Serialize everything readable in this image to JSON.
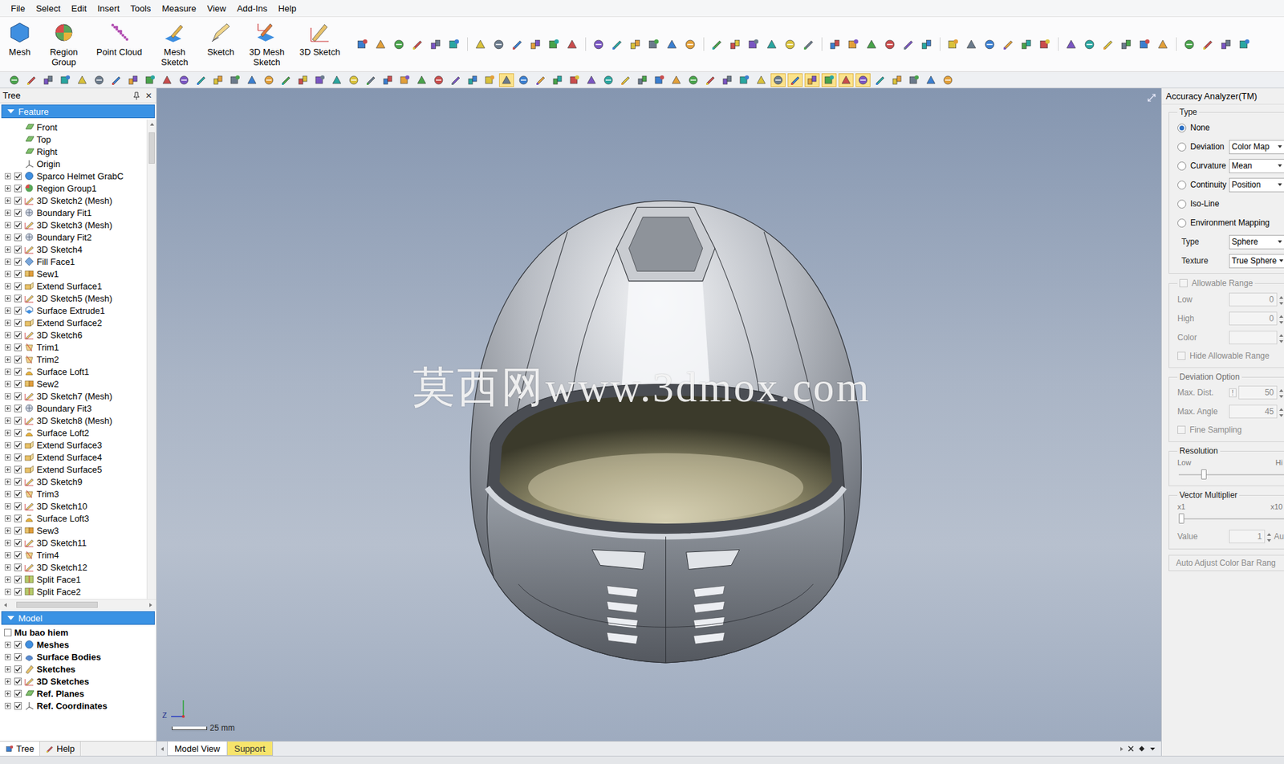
{
  "menu": [
    "File",
    "Select",
    "Edit",
    "Insert",
    "Tools",
    "Measure",
    "View",
    "Add-Ins",
    "Help"
  ],
  "ribbon": [
    {
      "label": "Mesh",
      "kind": "mesh"
    },
    {
      "label": "Region Group",
      "kind": "region"
    },
    {
      "label": "Point Cloud",
      "kind": "cloud"
    },
    {
      "label": "Mesh Sketch",
      "kind": "meshsketch"
    },
    {
      "label": "Sketch",
      "kind": "sketch"
    },
    {
      "label": "3D Mesh Sketch",
      "kind": "mesh3d"
    },
    {
      "label": "3D Sketch",
      "kind": "sketch3d"
    }
  ],
  "toolbar": [
    {
      "selected": false
    },
    {
      "selected": false
    },
    {
      "selected": false
    },
    {
      "selected": false
    },
    {
      "selected": false
    },
    {
      "selected": false
    },
    {
      "selected": false
    },
    {
      "selected": false
    },
    {
      "selected": false
    },
    {
      "selected": false
    },
    {
      "selected": false
    },
    {
      "selected": false
    },
    {
      "selected": false
    },
    {
      "selected": false
    },
    {
      "selected": false
    },
    {
      "selected": false
    },
    {
      "selected": false
    },
    {
      "selected": false
    },
    {
      "selected": false
    },
    {
      "selected": false
    },
    {
      "selected": false
    },
    {
      "selected": false
    },
    {
      "selected": false
    },
    {
      "selected": false
    },
    {
      "selected": false
    },
    {
      "selected": false
    },
    {
      "selected": false
    },
    {
      "selected": false
    },
    {
      "selected": false
    },
    {
      "selected": true
    },
    {
      "selected": false
    },
    {
      "selected": false
    },
    {
      "selected": false
    },
    {
      "selected": false
    },
    {
      "selected": false
    },
    {
      "selected": false
    },
    {
      "selected": false
    },
    {
      "selected": false
    },
    {
      "selected": false
    },
    {
      "selected": false
    },
    {
      "selected": false
    },
    {
      "selected": false
    },
    {
      "selected": false
    },
    {
      "selected": false
    },
    {
      "selected": false
    },
    {
      "selected": true
    },
    {
      "selected": true
    },
    {
      "selected": true
    },
    {
      "selected": true
    },
    {
      "selected": true
    },
    {
      "selected": true
    },
    {
      "selected": false
    },
    {
      "selected": false
    },
    {
      "selected": false
    },
    {
      "selected": false
    },
    {
      "selected": false
    }
  ],
  "tree": {
    "title": "Tree",
    "close": "✕"
  },
  "feature": {
    "title": "Feature",
    "expanded": true,
    "items": [
      {
        "label": "Front",
        "kind": "plane"
      },
      {
        "label": "Top",
        "kind": "plane"
      },
      {
        "label": "Right",
        "kind": "plane"
      },
      {
        "label": "Origin",
        "kind": "origin"
      },
      {
        "label": "Sparco Helmet GrabC",
        "kind": "mesh",
        "checked": true,
        "expanded": false
      },
      {
        "label": "Region Group1",
        "kind": "region",
        "checked": true,
        "expanded": false
      },
      {
        "label": "3D Sketch2 (Mesh)",
        "kind": "sketch",
        "checked": true,
        "expanded": false
      },
      {
        "label": "Boundary Fit1",
        "kind": "fit",
        "checked": true,
        "expanded": false
      },
      {
        "label": "3D Sketch3 (Mesh)",
        "kind": "sketch",
        "checked": true,
        "expanded": false
      },
      {
        "label": "Boundary Fit2",
        "kind": "fit",
        "checked": true,
        "expanded": false
      },
      {
        "label": "3D Sketch4",
        "kind": "sketch",
        "checked": true,
        "expanded": false
      },
      {
        "label": "Fill Face1",
        "kind": "fill",
        "checked": true,
        "expanded": false
      },
      {
        "label": "Sew1",
        "kind": "sew",
        "checked": true,
        "expanded": false
      },
      {
        "label": "Extend Surface1",
        "kind": "extend",
        "checked": true,
        "expanded": false
      },
      {
        "label": "3D Sketch5 (Mesh)",
        "kind": "sketch",
        "checked": true,
        "expanded": false
      },
      {
        "label": "Surface Extrude1",
        "kind": "extrude",
        "checked": true,
        "expanded": false
      },
      {
        "label": "Extend Surface2",
        "kind": "extend",
        "checked": true,
        "expanded": false
      },
      {
        "label": "3D Sketch6",
        "kind": "sketch",
        "checked": true,
        "expanded": false
      },
      {
        "label": "Trim1",
        "kind": "trim",
        "checked": true,
        "expanded": false
      },
      {
        "label": "Trim2",
        "kind": "trim",
        "checked": true,
        "expanded": false
      },
      {
        "label": "Surface Loft1",
        "kind": "loft",
        "checked": true,
        "expanded": false
      },
      {
        "label": "Sew2",
        "kind": "sew",
        "checked": true,
        "expanded": false
      },
      {
        "label": "3D Sketch7 (Mesh)",
        "kind": "sketch",
        "checked": true,
        "expanded": false
      },
      {
        "label": "Boundary Fit3",
        "kind": "fit",
        "checked": true,
        "expanded": false
      },
      {
        "label": "3D Sketch8 (Mesh)",
        "kind": "sketch",
        "checked": true,
        "expanded": false
      },
      {
        "label": "Surface Loft2",
        "kind": "loft",
        "checked": true,
        "expanded": false
      },
      {
        "label": "Extend Surface3",
        "kind": "extend",
        "checked": true,
        "expanded": false
      },
      {
        "label": "Extend Surface4",
        "kind": "extend",
        "checked": true,
        "expanded": false
      },
      {
        "label": "Extend Surface5",
        "kind": "extend",
        "checked": true,
        "expanded": false
      },
      {
        "label": "3D Sketch9",
        "kind": "sketch",
        "checked": true,
        "expanded": false
      },
      {
        "label": "Trim3",
        "kind": "trim",
        "checked": true,
        "expanded": false
      },
      {
        "label": "3D Sketch10",
        "kind": "sketch",
        "checked": true,
        "expanded": false
      },
      {
        "label": "Surface Loft3",
        "kind": "loft",
        "checked": true,
        "expanded": false
      },
      {
        "label": "Sew3",
        "kind": "sew",
        "checked": true,
        "expanded": false
      },
      {
        "label": "3D Sketch11",
        "kind": "sketch",
        "checked": true,
        "expanded": false
      },
      {
        "label": "Trim4",
        "kind": "trim",
        "checked": true,
        "expanded": false
      },
      {
        "label": "3D Sketch12",
        "kind": "sketch",
        "checked": true,
        "expanded": false
      },
      {
        "label": "Split Face1",
        "kind": "split",
        "checked": true,
        "expanded": false
      },
      {
        "label": "Split Face2",
        "kind": "split",
        "checked": true,
        "expanded": false
      }
    ]
  },
  "model": {
    "title": "Model",
    "expanded": true,
    "root": {
      "label": "Mu bao hiem",
      "checked": false
    },
    "items": [
      {
        "label": "Meshes",
        "kind": "mesh",
        "checked": true,
        "expanded": false
      },
      {
        "label": "Surface Bodies",
        "kind": "body",
        "checked": true,
        "expanded": false
      },
      {
        "label": "Sketches",
        "kind": "sketch2d",
        "checked": true,
        "expanded": false
      },
      {
        "label": "3D Sketches",
        "kind": "sketch",
        "checked": true,
        "expanded": false
      },
      {
        "label": "Ref. Planes",
        "kind": "plane",
        "checked": true,
        "expanded": false
      },
      {
        "label": "Ref. Coordinates",
        "kind": "origin",
        "checked": true,
        "expanded": false
      }
    ]
  },
  "left_tabs": [
    {
      "label": "Tree",
      "selected": true
    },
    {
      "label": "Help",
      "selected": false
    }
  ],
  "viewport": {
    "watermark": "莫西网www.3dmox.com",
    "axis": "Z",
    "scale": "25 mm"
  },
  "view_tabs": [
    {
      "label": "Model View",
      "selected": true,
      "color": "#ffffff"
    },
    {
      "label": "Support",
      "selected": false,
      "color": "#f6e46c"
    }
  ],
  "analyzer": {
    "title": "Accuracy Analyzer(TM)",
    "type_group": "Type",
    "options": [
      {
        "label": "None",
        "selected": true
      },
      {
        "label": "Deviation",
        "selected": false,
        "select": "Color Map"
      },
      {
        "label": "Curvature",
        "selected": false,
        "select": "Mean"
      },
      {
        "label": "Continuity",
        "selected": false,
        "select": "Position"
      },
      {
        "label": "Iso-Line",
        "selected": false
      },
      {
        "label": "Environment Mapping",
        "selected": false
      }
    ],
    "env_fields": [
      {
        "label": "Type",
        "value": "Sphere"
      },
      {
        "label": "Texture",
        "value": "True Sphere"
      }
    ],
    "allowable": {
      "label": "Allowable Range",
      "checked": false,
      "disabled": true,
      "fields": [
        {
          "label": "Low",
          "value": "0"
        },
        {
          "label": "High",
          "value": "0"
        },
        {
          "label": "Color",
          "value": ""
        }
      ],
      "hide": {
        "label": "Hide Allowable Range",
        "checked": false
      }
    },
    "deviation_option": {
      "title": "Deviation Option",
      "disabled": true,
      "fields": [
        {
          "label": "Max. Dist.",
          "value": "50",
          "flag": "!"
        },
        {
          "label": "Max. Angle",
          "value": "45"
        }
      ],
      "fine": {
        "label": "Fine Sampling",
        "checked": false
      }
    },
    "resolution": {
      "title": "Resolution",
      "low": "Low",
      "high": "Hi",
      "level": 0.22
    },
    "vector": {
      "title": "Vector Multiplier",
      "min": "x1",
      "max": "x10",
      "level": 0.0,
      "value_label": "Value",
      "value": "1",
      "auto": "Au"
    },
    "auto_adjust": "Auto Adjust Color Bar Rang"
  }
}
